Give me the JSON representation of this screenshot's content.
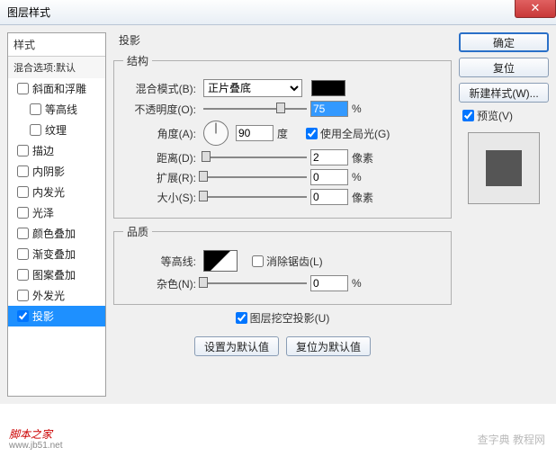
{
  "title": "图层样式",
  "styles_panel": {
    "header": "样式",
    "blend_default": "混合选项:默认",
    "items": [
      {
        "label": "斜面和浮雕",
        "checked": false,
        "indent": false
      },
      {
        "label": "等高线",
        "checked": false,
        "indent": true
      },
      {
        "label": "纹理",
        "checked": false,
        "indent": true
      },
      {
        "label": "描边",
        "checked": false,
        "indent": false
      },
      {
        "label": "内阴影",
        "checked": false,
        "indent": false
      },
      {
        "label": "内发光",
        "checked": false,
        "indent": false
      },
      {
        "label": "光泽",
        "checked": false,
        "indent": false
      },
      {
        "label": "颜色叠加",
        "checked": false,
        "indent": false
      },
      {
        "label": "渐变叠加",
        "checked": false,
        "indent": false
      },
      {
        "label": "图案叠加",
        "checked": false,
        "indent": false
      },
      {
        "label": "外发光",
        "checked": false,
        "indent": false
      },
      {
        "label": "投影",
        "checked": true,
        "indent": false,
        "selected": true
      }
    ]
  },
  "center": {
    "title": "投影",
    "structure": {
      "legend": "结构",
      "blend_mode_label": "混合模式(B):",
      "blend_mode_value": "正片叠底",
      "opacity_label": "不透明度(O):",
      "opacity_value": "75",
      "opacity_unit": "%",
      "opacity_pct": 75,
      "angle_label": "角度(A):",
      "angle_value": "90",
      "angle_unit": "度",
      "global_light": "使用全局光(G)",
      "global_light_checked": true,
      "distance_label": "距离(D):",
      "distance_value": "2",
      "distance_unit": "像素",
      "distance_pct": 3,
      "spread_label": "扩展(R):",
      "spread_value": "0",
      "spread_unit": "%",
      "spread_pct": 0,
      "size_label": "大小(S):",
      "size_value": "0",
      "size_unit": "像素",
      "size_pct": 0
    },
    "quality": {
      "legend": "品质",
      "contour_label": "等高线:",
      "antialias": "消除锯齿(L)",
      "antialias_checked": false,
      "noise_label": "杂色(N):",
      "noise_value": "0",
      "noise_unit": "%",
      "noise_pct": 0
    },
    "knockout": "图层挖空投影(U)",
    "knockout_checked": true,
    "make_default": "设置为默认值",
    "reset_default": "复位为默认值"
  },
  "right": {
    "ok": "确定",
    "reset": "复位",
    "new_style": "新建样式(W)...",
    "preview": "预览(V)",
    "preview_checked": true
  },
  "watermark": {
    "main": "脚本之家",
    "sub": "www.jb51.net",
    "right": "查字典 教程网"
  }
}
